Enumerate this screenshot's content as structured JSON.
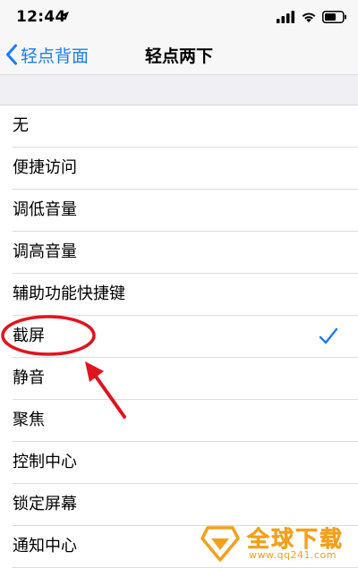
{
  "status_bar": {
    "time": "12:44",
    "icons": [
      "location-arrow-icon",
      "signal-icon",
      "wifi-icon",
      "battery-icon"
    ]
  },
  "nav": {
    "back_label": "轻点背面",
    "title": "轻点两下"
  },
  "options": [
    {
      "label": "无",
      "selected": false
    },
    {
      "label": "便捷访问",
      "selected": false
    },
    {
      "label": "调低音量",
      "selected": false
    },
    {
      "label": "调高音量",
      "selected": false
    },
    {
      "label": "辅助功能快捷键",
      "selected": false
    },
    {
      "label": "截屏",
      "selected": true
    },
    {
      "label": "静音",
      "selected": false
    },
    {
      "label": "聚焦",
      "selected": false
    },
    {
      "label": "控制中心",
      "selected": false
    },
    {
      "label": "锁定屏幕",
      "selected": false
    },
    {
      "label": "通知中心",
      "selected": false
    }
  ],
  "watermark": {
    "title": "全球下载",
    "url": "www.qq241.com"
  },
  "colors": {
    "accent": "#1a7cf6",
    "annotation": "#e0141e",
    "watermark": "#f3a01a",
    "bar_background": "#f7f7f7",
    "group_background": "#efeff4"
  }
}
